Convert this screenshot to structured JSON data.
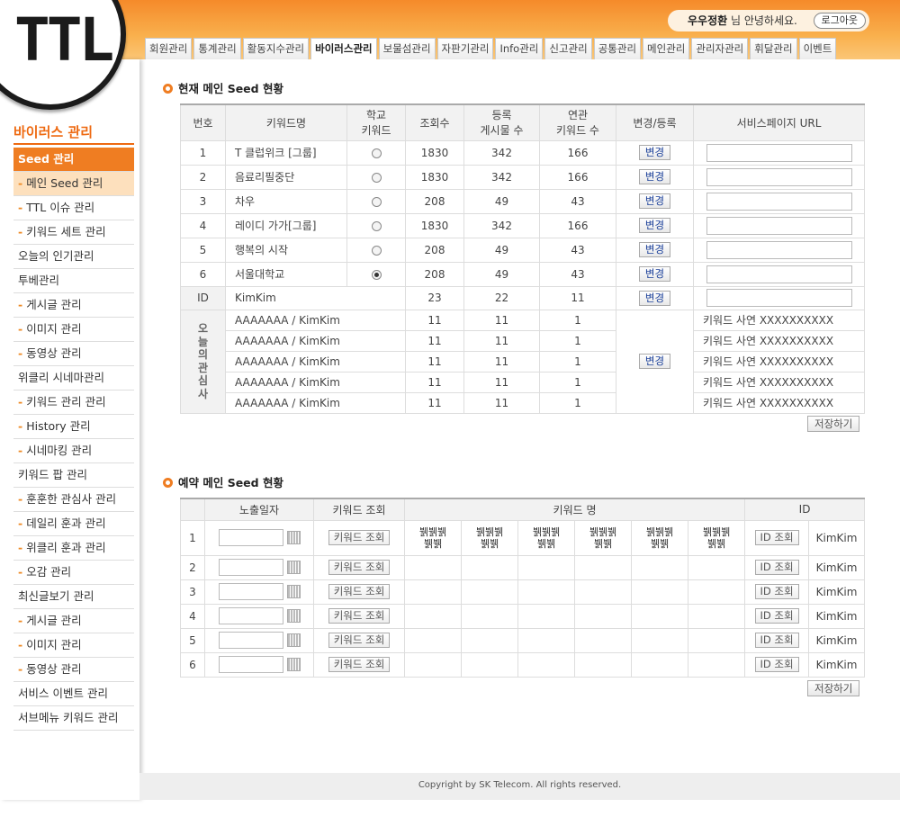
{
  "logo": "TTL",
  "greeting": {
    "user": "우우정환",
    "suffix": " 님 안녕하세요.",
    "logout": "로그아웃"
  },
  "tabs": [
    "회원관리",
    "통계관리",
    "활동지수관리",
    "바이러스관리",
    "보물섬관리",
    "자판기관리",
    "Info관리",
    "신고관리",
    "공통관리",
    "메인관리",
    "관리자관리",
    "휘달관리",
    "이벤트"
  ],
  "active_tab": 3,
  "sidebar": {
    "title": "바이러스 관리",
    "items": [
      {
        "label": "Seed 관리",
        "dash": false,
        "state": "current"
      },
      {
        "label": "메인 Seed 관리",
        "dash": true,
        "state": "selected"
      },
      {
        "label": "TTL 이슈 관리",
        "dash": true,
        "state": ""
      },
      {
        "label": "키워드 세트 관리",
        "dash": true,
        "state": ""
      },
      {
        "label": "오늘의 인기관리",
        "dash": false,
        "state": ""
      },
      {
        "label": "투베관리",
        "dash": false,
        "state": ""
      },
      {
        "label": "게시글 관리",
        "dash": true,
        "state": ""
      },
      {
        "label": "이미지 관리",
        "dash": true,
        "state": ""
      },
      {
        "label": "동영상 관리",
        "dash": true,
        "state": ""
      },
      {
        "label": "위클리 시네마관리",
        "dash": false,
        "state": ""
      },
      {
        "label": "키워드 관리 관리",
        "dash": true,
        "state": ""
      },
      {
        "label": "History 관리",
        "dash": true,
        "state": ""
      },
      {
        "label": "시네마킹 관리",
        "dash": true,
        "state": ""
      },
      {
        "label": "키워드 팝 관리",
        "dash": false,
        "state": ""
      },
      {
        "label": "훈훈한 관심사 관리",
        "dash": true,
        "state": ""
      },
      {
        "label": "데일리 훈과 관리",
        "dash": true,
        "state": ""
      },
      {
        "label": "위클리 훈과 관리",
        "dash": true,
        "state": ""
      },
      {
        "label": "오감 관리",
        "dash": true,
        "state": ""
      },
      {
        "label": "최신글보기 관리",
        "dash": false,
        "state": ""
      },
      {
        "label": "게시글 관리",
        "dash": true,
        "state": ""
      },
      {
        "label": "이미지 관리",
        "dash": true,
        "state": ""
      },
      {
        "label": "동영상 관리",
        "dash": true,
        "state": ""
      },
      {
        "label": "서비스 이벤트 관리",
        "dash": false,
        "state": ""
      },
      {
        "label": "서브메뉴 키워드 관리",
        "dash": false,
        "state": ""
      }
    ]
  },
  "current_seed": {
    "title": "현재 메인 Seed 현황",
    "headers": {
      "no": "번호",
      "keyword": "키워드명",
      "school1": "학교",
      "school2": "키워드",
      "views": "조회수",
      "reg1": "등록",
      "reg2": "게시물 수",
      "rel1": "연관",
      "rel2": "키워드 수",
      "change": "변경/등록",
      "url": "서비스페이지 URL"
    },
    "rows": [
      {
        "no": "1",
        "keyword": "T 클럽위크 [그룹]",
        "school": false,
        "views": "1830",
        "posts": "342",
        "related": "166"
      },
      {
        "no": "2",
        "keyword": "음료리필중단",
        "school": false,
        "views": "1830",
        "posts": "342",
        "related": "166"
      },
      {
        "no": "3",
        "keyword": "차우",
        "school": false,
        "views": "208",
        "posts": "49",
        "related": "43"
      },
      {
        "no": "4",
        "keyword": "레이디 가가[그룹]",
        "school": false,
        "views": "1830",
        "posts": "342",
        "related": "166"
      },
      {
        "no": "5",
        "keyword": "행복의 시작",
        "school": false,
        "views": "208",
        "posts": "49",
        "related": "43"
      },
      {
        "no": "6",
        "keyword": "서울대학교",
        "school": true,
        "views": "208",
        "posts": "49",
        "related": "43"
      }
    ],
    "id_row": {
      "label": "ID",
      "keyword": "KimKim",
      "views": "23",
      "posts": "22",
      "related": "11"
    },
    "interest": {
      "label": [
        "오",
        "늘",
        "의",
        "관",
        "심",
        "사"
      ],
      "rows": [
        {
          "keyword": "AAAAAAA / KimKim",
          "views": "11",
          "posts": "11",
          "related": "1",
          "note": "키워드 사연 XXXXXXXXXX"
        },
        {
          "keyword": "AAAAAAA / KimKim",
          "views": "11",
          "posts": "11",
          "related": "1",
          "note": "키워드 사연 XXXXXXXXXX"
        },
        {
          "keyword": "AAAAAAA / KimKim",
          "views": "11",
          "posts": "11",
          "related": "1",
          "note": "키워드 사연 XXXXXXXXXX"
        },
        {
          "keyword": "AAAAAAA / KimKim",
          "views": "11",
          "posts": "11",
          "related": "1",
          "note": "키워드 사연 XXXXXXXXXX"
        },
        {
          "keyword": "AAAAAAA / KimKim",
          "views": "11",
          "posts": "11",
          "related": "1",
          "note": "키워드 사연 XXXXXXXXXX"
        }
      ]
    },
    "change_btn": "변경",
    "save": "저장하기"
  },
  "reserved_seed": {
    "title": "예약 메인 Seed 현황",
    "headers": {
      "date": "노출일자",
      "kw_query": "키워드 조회",
      "kw_name": "키워드 명",
      "id": "ID"
    },
    "rows": [
      {
        "no": "1",
        "kw": [
          "뷁뷁뷁 뷁뷁",
          "뷁뷁뷁 뷁뷁",
          "뷁뷁뷁 뷁뷁",
          "뷁뷁뷁 뷁뷁",
          "뷁뷁뷁 뷁뷁",
          "뷁뷁뷁 뷁뷁"
        ],
        "id": "KimKim"
      },
      {
        "no": "2",
        "kw": [
          "",
          "",
          "",
          "",
          "",
          ""
        ],
        "id": "KimKim"
      },
      {
        "no": "3",
        "kw": [
          "",
          "",
          "",
          "",
          "",
          ""
        ],
        "id": "KimKim"
      },
      {
        "no": "4",
        "kw": [
          "",
          "",
          "",
          "",
          "",
          ""
        ],
        "id": "KimKim"
      },
      {
        "no": "5",
        "kw": [
          "",
          "",
          "",
          "",
          "",
          ""
        ],
        "id": "KimKim"
      },
      {
        "no": "6",
        "kw": [
          "",
          "",
          "",
          "",
          "",
          ""
        ],
        "id": "KimKim"
      }
    ],
    "kw_btn": "키워드 조회",
    "id_btn": "ID 조회",
    "save": "저장하기"
  },
  "footer": "Copyright by SK Telecom.  All rights reserved.",
  "colors": {
    "accent": "#ef7d22",
    "link_blue": "#1a3f99"
  }
}
